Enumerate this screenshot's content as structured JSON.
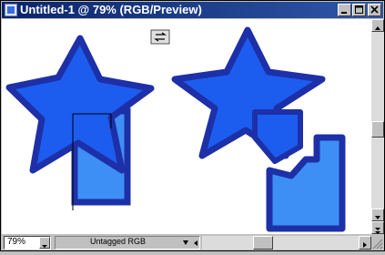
{
  "window": {
    "title": "Untitled-1 @ 79% (RGB/Preview)",
    "buttons": [
      "minimize",
      "maximize",
      "close"
    ]
  },
  "canvas": {
    "background": "#ffffff",
    "star_fill": "#1c5df0",
    "star_stroke": "#1d30a8",
    "square_fill": "#3d8ff5",
    "square_stroke": "#1d30a8"
  },
  "status": {
    "zoom": "79%",
    "profile": "Untagged RGB"
  },
  "icons": {
    "toggle": "preview-toggle-icon",
    "doc": "document-icon"
  }
}
